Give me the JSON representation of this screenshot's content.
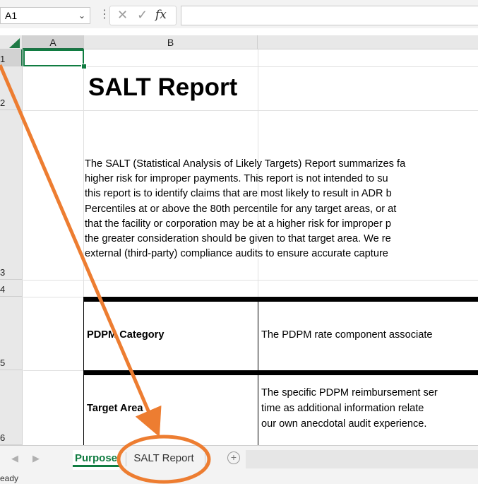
{
  "formula_bar": {
    "name_box": "A1",
    "dropdown_glyph": "⌄",
    "more_glyph": "⋮",
    "cancel_glyph": "✕",
    "enter_glyph": "✓",
    "fx_label": "fx",
    "formula_value": ""
  },
  "columns": [
    "A",
    "B"
  ],
  "rows": [
    "1",
    "2",
    "3",
    "4",
    "5",
    "6"
  ],
  "sheet": {
    "title": "SALT Report",
    "paragraph_lines": [
      "The SALT (Statistical Analysis of Likely Targets) Report summarizes fa",
      "higher risk for improper payments.  This report is not intended to su",
      "this report is to identify claims that are most likely to result in ADR b",
      "Percentiles at or above the 80th percentile for any target areas, or at",
      "that the facility or corporation may be at a higher risk for improper p",
      "the greater consideration should be given to that target area.  We re",
      "external (third-party) compliance audits to ensure accurate capture"
    ],
    "table": [
      {
        "label": "PDPM Category",
        "desc_lines": [
          "The PDPM rate component associate"
        ]
      },
      {
        "label": "Target Area",
        "desc_lines": [
          "The specific PDPM reimbursement ser",
          "time as additional information relate",
          "our own anecdotal audit experience."
        ]
      }
    ]
  },
  "tabs": {
    "prev_glyph": "◀",
    "next_glyph": "▶",
    "items": [
      {
        "label": "Purpose",
        "active": true
      },
      {
        "label": "SALT Report",
        "active": false
      }
    ],
    "add_glyph": "+"
  },
  "status": {
    "text": "eady"
  },
  "colors": {
    "excel_green": "#107c41",
    "annotation_orange": "#ed7d31"
  }
}
